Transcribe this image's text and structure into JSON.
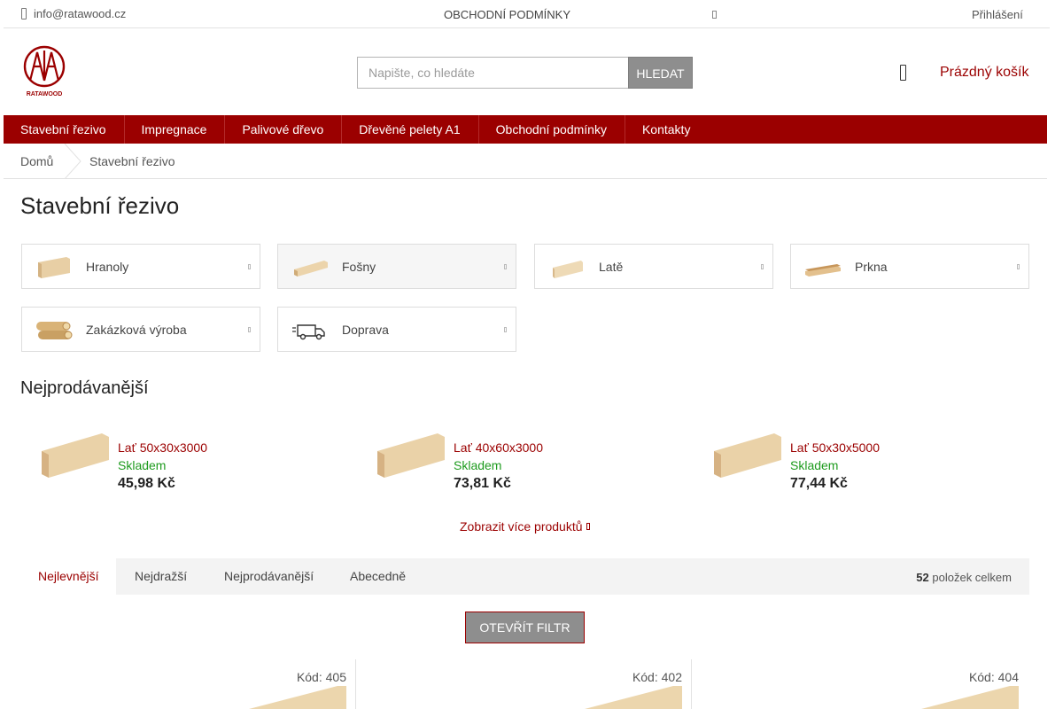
{
  "topbar": {
    "email": "info@ratawood.cz",
    "terms": "OBCHODNÍ PODMÍNKY",
    "login": "Přihlášení"
  },
  "logo": {
    "text": "RATAWOOD"
  },
  "search": {
    "placeholder": "Napište, co hledáte",
    "button": "HLEDAT"
  },
  "cart": {
    "label": "Prázdný košík"
  },
  "nav": {
    "items": [
      "Stavební řezivo",
      "Impregnace",
      "Palivové dřevo",
      "Dřevěné pelety A1",
      "Obchodní podmínky",
      "Kontakty"
    ]
  },
  "breadcrumb": {
    "home": "Domů",
    "current": "Stavební řezivo"
  },
  "page": {
    "title": "Stavební řezivo"
  },
  "categories": [
    {
      "label": "Hranoly",
      "icon": "beam-icon"
    },
    {
      "label": "Fošny",
      "icon": "plank-icon"
    },
    {
      "label": "Latě",
      "icon": "lath-icon"
    },
    {
      "label": "Prkna",
      "icon": "board-icon"
    },
    {
      "label": "Zakázková výroba",
      "icon": "logs-icon"
    },
    {
      "label": "Doprava",
      "icon": "truck-icon"
    }
  ],
  "bestsellers": {
    "title": "Nejprodávanější",
    "items": [
      {
        "name": "Lať 50x30x3000",
        "stock": "Skladem",
        "price": "45,98 Kč"
      },
      {
        "name": "Lať 40x60x3000",
        "stock": "Skladem",
        "price": "73,81 Kč"
      },
      {
        "name": "Lať 50x30x5000",
        "stock": "Skladem",
        "price": "77,44 Kč"
      }
    ],
    "more": "Zobrazit více produktů"
  },
  "sort": {
    "tabs": [
      "Nejlevnější",
      "Nejdražší",
      "Nejprodávanější",
      "Abecedně"
    ],
    "active": "Nejlevnější",
    "count": "52",
    "count_suffix": "položek celkem"
  },
  "filter": {
    "button": "OTEVŘÍT FILTR"
  },
  "products": [
    {
      "code": "Kód: 405"
    },
    {
      "code": "Kód: 402"
    },
    {
      "code": "Kód: 404"
    }
  ],
  "colors": {
    "brand": "#9b0000",
    "stock": "#1e9b1e",
    "button_grey": "#8e8e8e"
  }
}
